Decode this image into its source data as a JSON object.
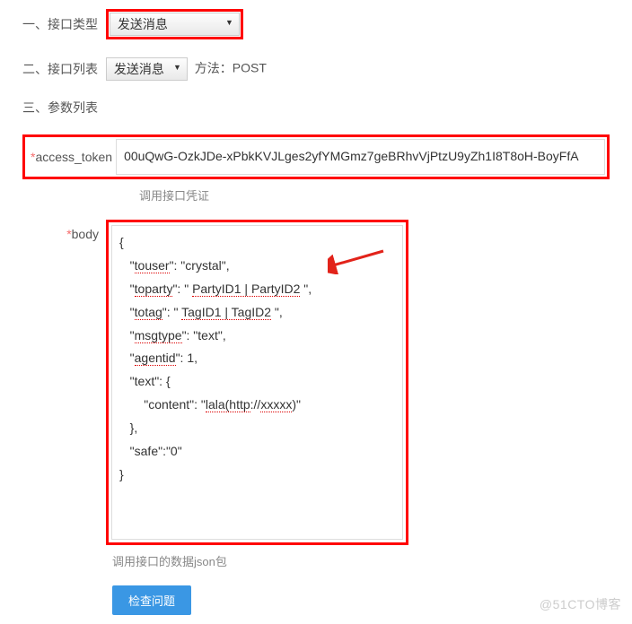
{
  "section1": {
    "label": "一、接口类型",
    "selected": "发送消息"
  },
  "section2": {
    "label": "二、接口列表",
    "selected": "发送消息",
    "method_label": "方法：",
    "method_value": "POST"
  },
  "section3": {
    "label": "三、参数列表"
  },
  "token": {
    "label": "access_token",
    "star": "*",
    "value": "00uQwG-OzkJDe-xPbkKVJLges2yfYMGmz7geBRhvVjPtzU9yZh1I8T8oH-BoyFfA",
    "hint": "调用接口凭证"
  },
  "body": {
    "star": "*",
    "label": "body",
    "json": {
      "l1": "{",
      "l2a": "   \"",
      "l2b": "touser",
      "l2c": "\": \"crystal\",",
      "l3a": "   \"",
      "l3b": "toparty",
      "l3c": "\": \" ",
      "l3d": "PartyID1 | PartyID2",
      "l3e": " \",",
      "l4a": "   \"",
      "l4b": "totag",
      "l4c": "\": \" ",
      "l4d": "TagID1 | TagID2",
      "l4e": " \",",
      "l5a": "   \"",
      "l5b": "msgtype",
      "l5c": "\": \"text\",",
      "l6a": "   \"",
      "l6b": "agentid",
      "l6c": "\": 1,",
      "l7": "   \"text\": {",
      "l8a": "       \"content\": \"",
      "l8b": "lala(http",
      "l8c": "://",
      "l8d": "xxxxx",
      "l8e": ")\"",
      "l9": "   },",
      "l10": "   \"safe\":\"0\"",
      "l11": "}"
    },
    "hint": "调用接口的数据json包"
  },
  "button": {
    "check": "检查问题"
  },
  "watermark": "@51CTO博客"
}
